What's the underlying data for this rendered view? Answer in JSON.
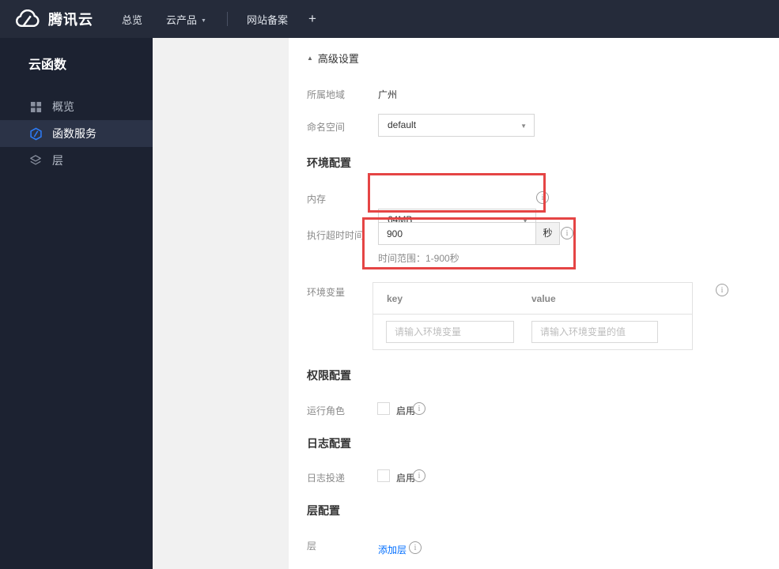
{
  "colors": {
    "accent_blue": "#006eff",
    "highlight_red": "#e54545",
    "nav_bg": "#252b3a",
    "sidebar_bg": "#1c2231",
    "sidebar_active_bg": "#2b3347"
  },
  "icons": {
    "collapse_triangle": "▲",
    "dropdown_caret": "▼",
    "nav_caret": "▼",
    "info": "i",
    "plus": "+"
  },
  "nav": {
    "brand": "腾讯云",
    "items": [
      {
        "label": "总览"
      },
      {
        "label": "云产品"
      },
      {
        "label": "网站备案"
      }
    ]
  },
  "sidebar": {
    "title": "云函数",
    "items": [
      {
        "label": "概览",
        "icon": "grid-icon",
        "active": false
      },
      {
        "label": "函数服务",
        "icon": "function-icon",
        "active": true
      },
      {
        "label": "层",
        "icon": "layers-icon",
        "active": false
      }
    ]
  },
  "form": {
    "advanced_settings": "高级设置",
    "region": {
      "label": "所属地域",
      "value": "广州"
    },
    "namespace": {
      "label": "命名空间",
      "value": "default"
    },
    "env_section": "环境配置",
    "memory": {
      "label": "内存",
      "value": "64MB"
    },
    "timeout": {
      "label": "执行超时时间",
      "value": "900",
      "unit": "秒",
      "hint": "时间范围：1-900秒"
    },
    "env_vars": {
      "label": "环境变量",
      "key_header": "key",
      "value_header": "value",
      "key_placeholder": "请输入环境变量",
      "value_placeholder": "请输入环境变量的值"
    },
    "perm_section": "权限配置",
    "role": {
      "label": "运行角色",
      "enable": "启用"
    },
    "log_section": "日志配置",
    "log": {
      "label": "日志投递",
      "enable": "启用"
    },
    "layer_section": "层配置",
    "layer": {
      "label": "层",
      "add_link": "添加层"
    }
  }
}
